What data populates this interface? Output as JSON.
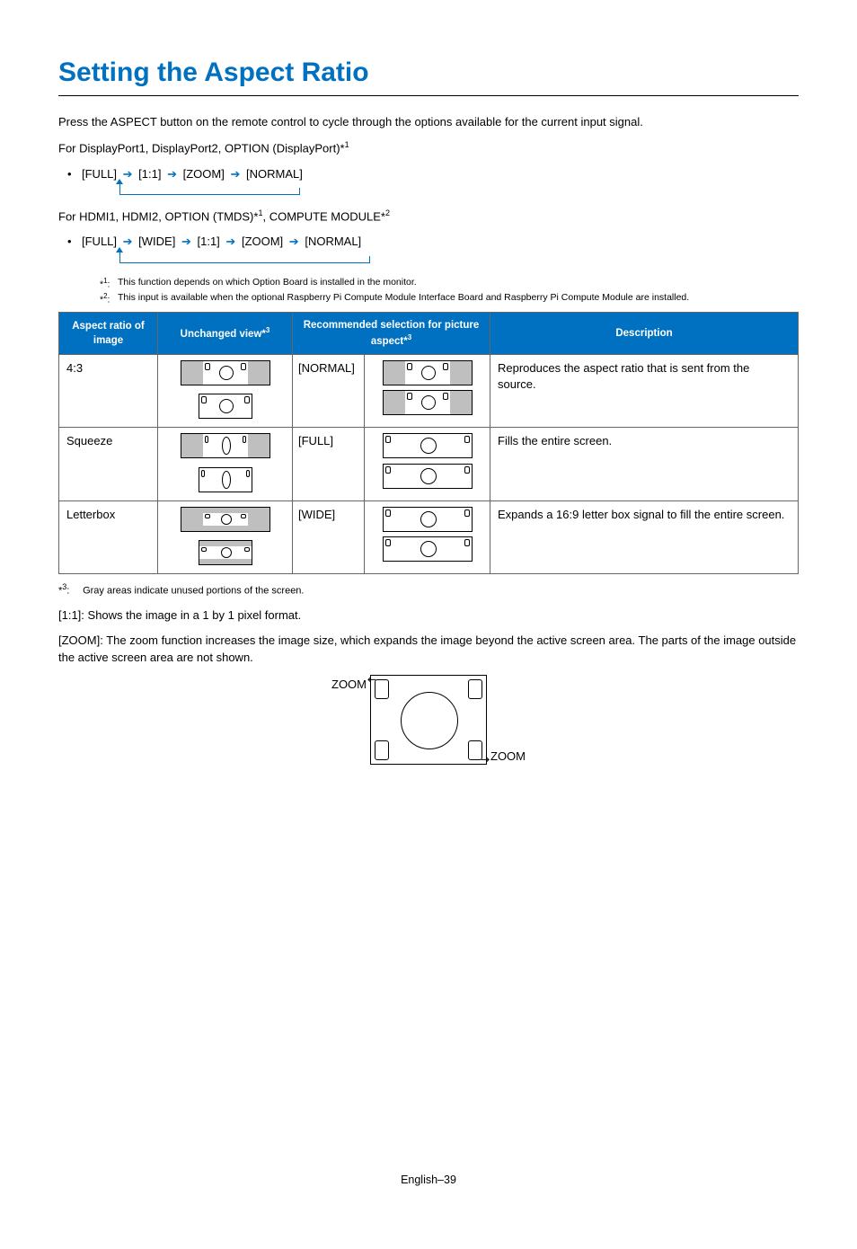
{
  "title": "Setting the Aspect Ratio",
  "intro": "Press the ASPECT button on the remote control to cycle through the options available for the current input signal.",
  "line_dp": "For DisplayPort1, DisplayPort2, OPTION (DisplayPort)*",
  "line_dp_sup": "1",
  "cycle_dp": [
    "[FULL]",
    "[1:1]",
    "[ZOOM]",
    "[NORMAL]"
  ],
  "line_hdmi_a": "For HDMI1, HDMI2, OPTION (TMDS)*",
  "line_hdmi_sup1": "1",
  "line_hdmi_b": ", COMPUTE MODULE*",
  "line_hdmi_sup2": "2",
  "cycle_hdmi": [
    "[FULL]",
    "[WIDE]",
    "[1:1]",
    "[ZOOM]",
    "[NORMAL]"
  ],
  "footnotes_upper": [
    {
      "mark": "1",
      "text": "This function depends on which Option Board is installed in the monitor."
    },
    {
      "mark": "2",
      "text": "This input is available when the optional Raspberry Pi Compute Module Interface Board and Raspberry Pi Compute Module are installed."
    }
  ],
  "table": {
    "headers": {
      "h1": "Aspect ratio of image",
      "h2a": "Unchanged view*",
      "h2s": "3",
      "h3a": "Recommended selection for picture aspect*",
      "h3s": "3",
      "h4": "Description"
    },
    "rows": [
      {
        "ratio": "4:3",
        "rec": "[NORMAL]",
        "desc": "Reproduces the aspect ratio that is sent from the source."
      },
      {
        "ratio": "Squeeze",
        "rec": "[FULL]",
        "desc": "Fills the entire screen."
      },
      {
        "ratio": "Letterbox",
        "rec": "[WIDE]",
        "desc": "Expands a 16:9 letter box signal to fill the entire screen."
      }
    ]
  },
  "footnote3_mark": "3",
  "footnote3_text": "Gray areas indicate unused portions of the screen.",
  "note_11": "[1:1]: Shows the image in a 1 by 1 pixel format.",
  "note_zoom": "[ZOOM]: The zoom function increases the image size, which expands the image beyond the active screen area. The parts of the image outside the active screen area are not shown.",
  "zoom_label": "ZOOM",
  "page_footer": "English–39"
}
